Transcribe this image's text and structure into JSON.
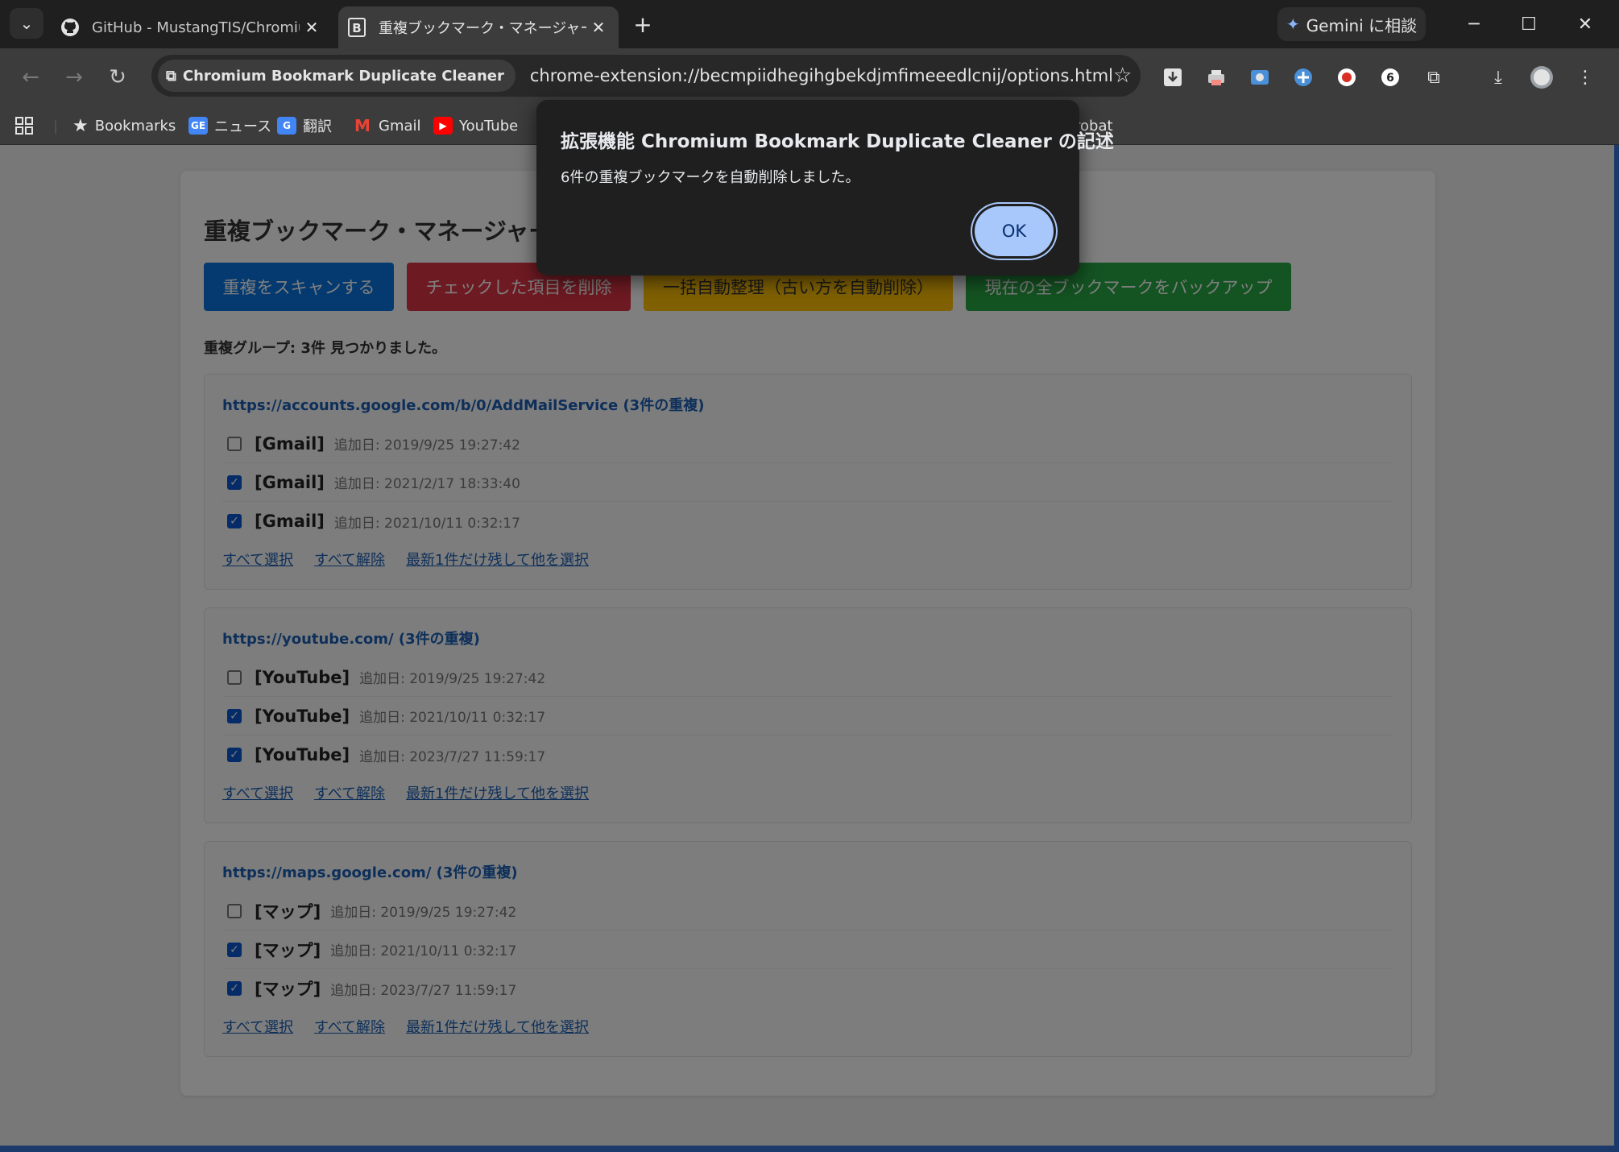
{
  "browser": {
    "tabs": [
      {
        "title": "GitHub - MustangTIS/Chromium",
        "icon": "github-icon",
        "active": false
      },
      {
        "title": "重複ブックマーク・マネージャー",
        "icon": "extension-b-icon",
        "active": true
      }
    ],
    "gemini_label": "Gemini に相談",
    "omnibox": {
      "chip": "Chromium Bookmark Duplicate Cleaner",
      "url": "chrome-extension://becmpiidhegihgbekdjmfimeeedlcnij/options.html"
    },
    "bookmarks": [
      {
        "label": "Bookmarks",
        "icon": "star-icon"
      },
      {
        "label": "ニュース",
        "icon": "google-news-icon"
      },
      {
        "label": "翻訳",
        "icon": "google-translate-icon"
      },
      {
        "label": "Gmail",
        "icon": "gmail-icon"
      },
      {
        "label": "YouTube",
        "icon": "youtube-icon"
      },
      {
        "label": "robat",
        "icon": "acrobat-icon"
      }
    ]
  },
  "page": {
    "title": "重複ブックマーク・マネージャー",
    "buttons": {
      "scan": "重複をスキャンする",
      "delete": "チェックした項目を削除",
      "auto": "一括自動整理（古い方を自動削除）",
      "backup": "現在の全ブックマークをバックアップ"
    },
    "summary": "重複グループ: 3件 見つかりました。",
    "links": {
      "select_all": "すべて選択",
      "deselect_all": "すべて解除",
      "keep_latest": "最新1件だけ残して他を選択"
    },
    "groups": [
      {
        "url": "https://accounts.google.com/b/0/AddMailService (3件の重複)",
        "items": [
          {
            "name": "[Gmail]",
            "date": "追加日: 2019/9/25 19:27:42",
            "checked": false
          },
          {
            "name": "[Gmail]",
            "date": "追加日: 2021/2/17 18:33:40",
            "checked": true
          },
          {
            "name": "[Gmail]",
            "date": "追加日: 2021/10/11 0:32:17",
            "checked": true
          }
        ]
      },
      {
        "url": "https://youtube.com/ (3件の重複)",
        "items": [
          {
            "name": "[YouTube]",
            "date": "追加日: 2019/9/25 19:27:42",
            "checked": false
          },
          {
            "name": "[YouTube]",
            "date": "追加日: 2021/10/11 0:32:17",
            "checked": true
          },
          {
            "name": "[YouTube]",
            "date": "追加日: 2023/7/27 11:59:17",
            "checked": true
          }
        ]
      },
      {
        "url": "https://maps.google.com/ (3件の重複)",
        "items": [
          {
            "name": "[マップ]",
            "date": "追加日: 2019/9/25 19:27:42",
            "checked": false
          },
          {
            "name": "[マップ]",
            "date": "追加日: 2021/10/11 0:32:17",
            "checked": true
          },
          {
            "name": "[マップ]",
            "date": "追加日: 2023/7/27 11:59:17",
            "checked": true
          }
        ]
      }
    ]
  },
  "dialog": {
    "title": "拡張機能 Chromium Bookmark Duplicate Cleaner の記述",
    "message": "6件の重複ブックマークを自動削除しました。",
    "ok": "OK"
  },
  "colors": {
    "scan": "#0b74e0",
    "delete": "#dc3545",
    "auto": "#ffc107",
    "backup": "#28a745",
    "dialog_button": "#a8c7fa"
  }
}
